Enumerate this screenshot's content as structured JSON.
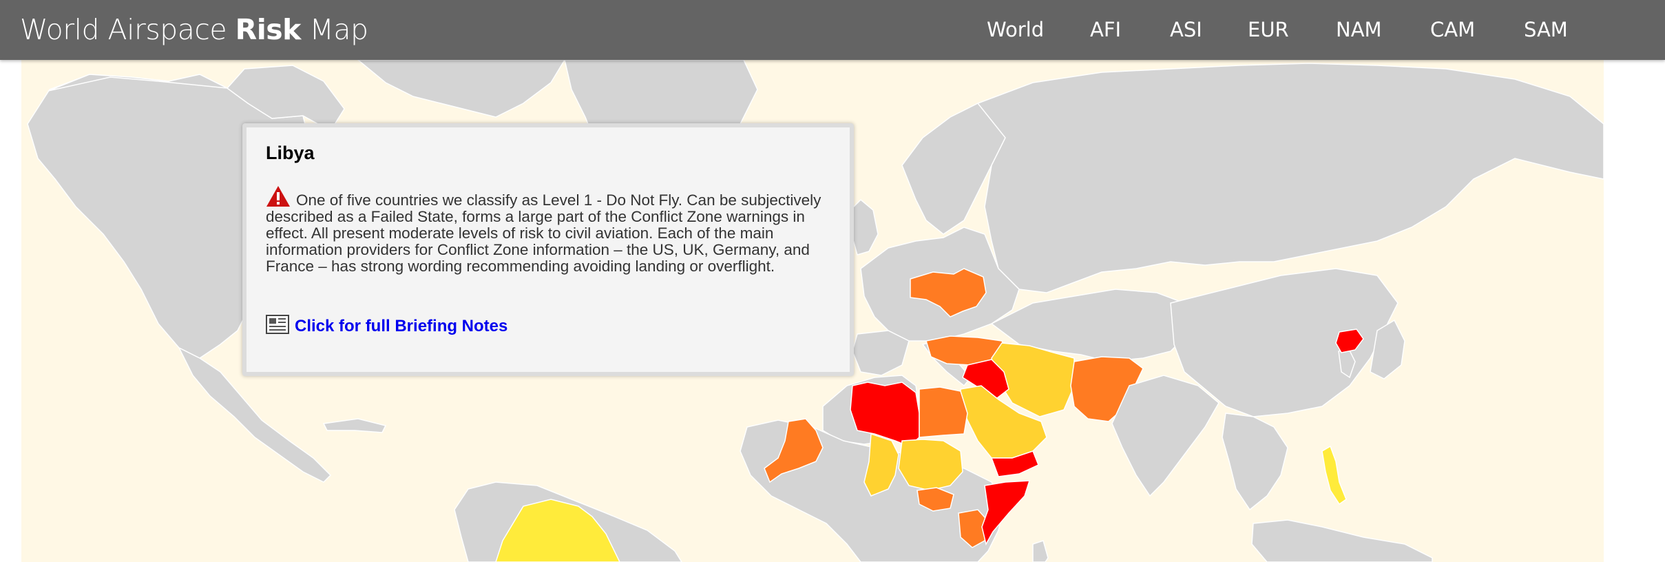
{
  "header": {
    "title_prefix": "World Airspace ",
    "title_bold": "Risk",
    "title_suffix": " Map",
    "nav": [
      "World",
      "AFI",
      "ASI",
      "EUR",
      "NAM",
      "CAM",
      "SAM"
    ]
  },
  "colors": {
    "header_bg": "#646464",
    "map_background": "#fff8e5",
    "land": "#d4d4d4",
    "level_1_do_not_fly": "#ff0000",
    "high_risk": "#ff7b22",
    "medium_risk": "#ffd230",
    "low_risk": "#ffeb3b",
    "link": "#0000ee"
  },
  "map": {
    "highlighted_countries": {
      "red": [
        "Libya",
        "Iraq",
        "North Korea",
        "Somalia",
        "Yemen"
      ],
      "orange": [
        "Ukraine",
        "Turkey",
        "Afghanistan",
        "Pakistan",
        "Egypt",
        "Mali",
        "South Sudan",
        "Kenya"
      ],
      "amber": [
        "Saudi Arabia",
        "Iran",
        "Sudan",
        "Chad"
      ],
      "yellow": [
        "Philippines",
        "Venezuela"
      ]
    }
  },
  "info_panel": {
    "country": "Libya",
    "icon": "warning-triangle-icon",
    "description": "One of five countries we classify as Level 1 - Do Not Fly. Can be subjectively described as a Failed State, forms a large part of the Conflict Zone warnings in effect. All present moderate levels of risk to civil aviation. Each of the main information providers for Conflict Zone information – the US, UK, Germany, and France – has strong wording recommending avoiding landing or overflight.",
    "link_icon": "document-icon",
    "link_text": "Click for full Briefing Notes"
  }
}
